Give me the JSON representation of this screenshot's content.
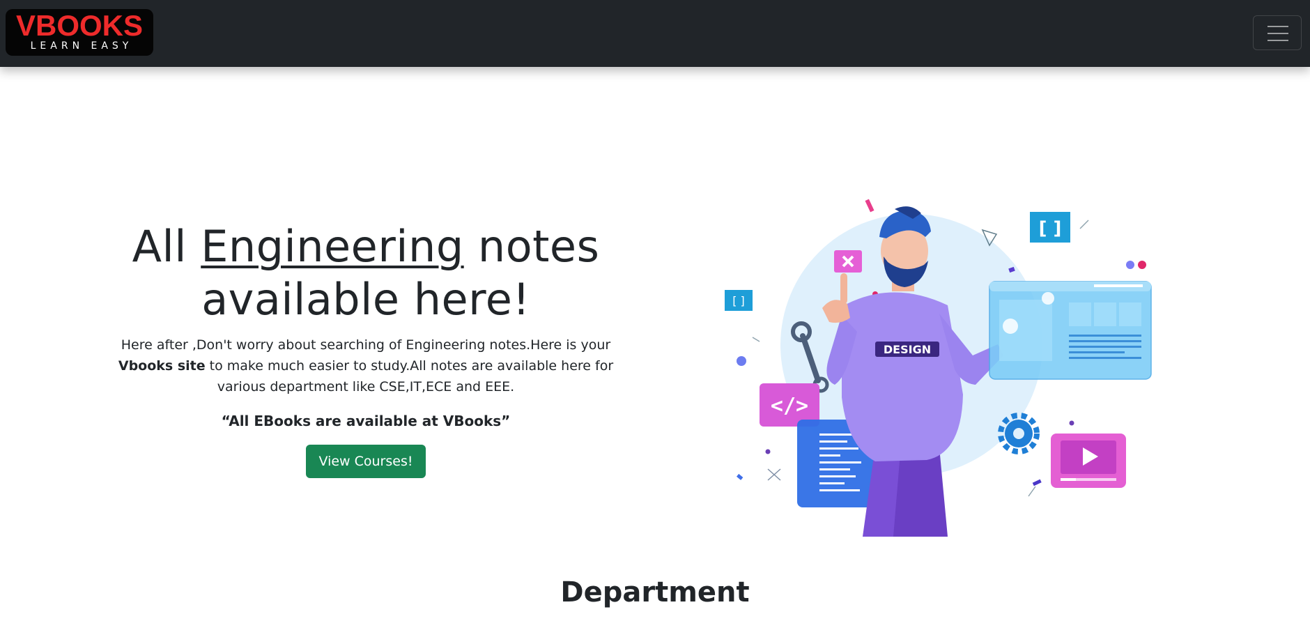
{
  "navbar": {
    "logo_main": "VBOOKS",
    "logo_sub": "LEARN EASY",
    "menu_icon": "hamburger-menu-icon",
    "background": "#212529"
  },
  "hero": {
    "headline_pre": "All ",
    "headline_underlined": "Engineering",
    "headline_post": " notes available here!",
    "lead_part1": "Here after ,Don't worry about searching of Engineering notes.Here is your",
    "lead_bold": "Vbooks site",
    "lead_part2": " to make much easier to study.All notes are available here for various department like CSE,IT,ECE and EEE.",
    "quote": "“All EBooks are available at VBooks”",
    "button_label": "View Courses!",
    "button_color": "#198754",
    "illustration_badge": "DESIGN"
  },
  "department": {
    "title": "Department"
  }
}
